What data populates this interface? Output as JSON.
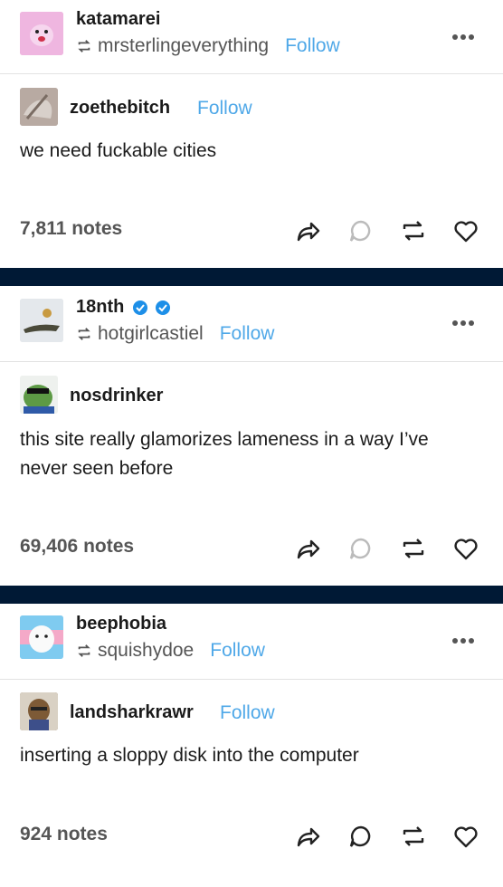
{
  "posts": [
    {
      "header": {
        "username": "katamarei",
        "reblogged_from": "mrsterlingeverything",
        "follow_label": "Follow"
      },
      "original": {
        "username": "zoethebitch",
        "follow_label": "Follow"
      },
      "body": "we need fuckable cities",
      "notes": "7,811 notes"
    },
    {
      "header": {
        "username": "18nth",
        "reblogged_from": "hotgirlcastiel",
        "follow_label": "Follow"
      },
      "original": {
        "username": "nosdrinker"
      },
      "body": "this site really glamorizes lameness in a way I’ve never seen before",
      "notes": "69,406 notes"
    },
    {
      "header": {
        "username": "beephobia",
        "reblogged_from": "squishydoe",
        "follow_label": "Follow"
      },
      "original": {
        "username": "landsharkrawr",
        "follow_label": "Follow"
      },
      "body": "inserting a sloppy disk into the computer",
      "notes": "924 notes"
    }
  ],
  "icons": {
    "reblog": "reblog-icon",
    "share": "share-icon",
    "reply": "reply-icon",
    "like": "heart-icon",
    "more": "more-icon",
    "verified": "verified-badge-icon"
  },
  "colors": {
    "follow": "#4fa8e8",
    "separator": "#001935",
    "text": "#1b1b1b",
    "muted": "#555555"
  }
}
